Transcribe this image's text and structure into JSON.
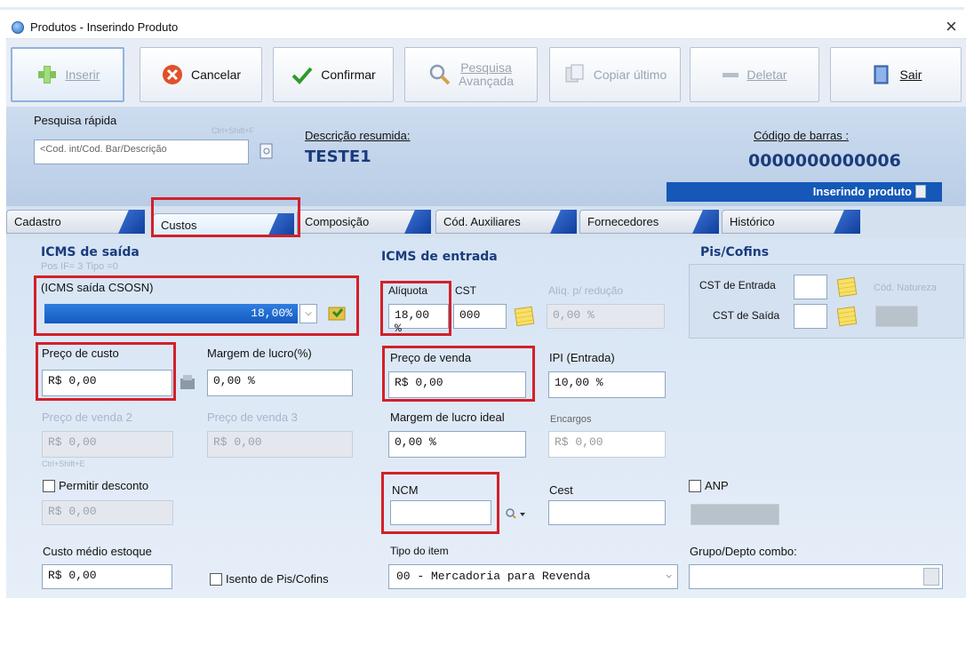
{
  "window": {
    "title": "Produtos - Inserindo Produto",
    "close": "×"
  },
  "toolbar": {
    "insert": "Inserir",
    "cancel": "Cancelar",
    "confirm": "Confirmar",
    "advanced_search_1": "Pesquisa",
    "advanced_search_2": "Avançada",
    "copy_last": "Copiar último",
    "delete": "Deletar",
    "exit": "Sair"
  },
  "header": {
    "quick_search_label": "Pesquisa rápida",
    "quick_search_hint": "Ctrl+Shift+F",
    "quick_search_placeholder": "<Cod. int/Cod. Bar/Descrição",
    "short_desc_label": "Descrição resumida:",
    "short_desc_value": "TESTE1",
    "barcode_label": "Código de barras :",
    "barcode_value": "0000000000006",
    "status": "Inserindo produto"
  },
  "tabs": [
    "Cadastro",
    "Custos",
    "Composição",
    "Cód. Auxiliares",
    "Fornecedores",
    "Histórico"
  ],
  "icms_saida": {
    "title": "ICMS de saída",
    "sub": "Pos IF= 3    Tipo =0",
    "csosn_label": "(ICMS saída CSOSN)",
    "csosn_value": "18,00%"
  },
  "icms_entrada": {
    "title": "ICMS de entrada",
    "aliquota_label": "Alíquota",
    "aliquota_value": "18,00 %",
    "cst_label": "CST",
    "cst_value": "000",
    "reducao_label": "Alíq. p/ redução",
    "reducao_value": "0,00 %"
  },
  "pis": {
    "title": "Pis/Cofins",
    "cst_entrada": "CST de Entrada",
    "cst_saida": "CST de Saída",
    "cod_natureza": "Cód. Natureza"
  },
  "prices": {
    "custo_label": "Preço de custo",
    "custo_value": "R$ 0,00",
    "margem_label": "Margem de lucro(%)",
    "margem_value": "0,00 %",
    "venda_label": "Preço de venda",
    "venda_value": "R$ 0,00",
    "ipi_label": "IPI (Entrada)",
    "ipi_value": "10,00 %",
    "venda2_label": "Preço de venda 2",
    "venda2_value": "R$ 0,00",
    "venda3_label": "Preço de venda 3",
    "venda3_value": "R$ 0,00",
    "shortcut": "Ctrl+Shift+E",
    "margem_ideal_label": "Margem de lucro ideal",
    "margem_ideal_value": "0,00 %",
    "encargos_label": "Encargos",
    "encargos_value": "R$ 0,00"
  },
  "misc": {
    "permitir_desconto": "Permitir desconto",
    "desconto_value": "R$ 0,00",
    "ncm_label": "NCM",
    "cest_label": "Cest",
    "anp_label": "ANP",
    "custo_medio_label": "Custo médio estoque",
    "custo_medio_value": "R$ 0,00",
    "isento": "Isento de Pis/Cofins",
    "tipo_item_label": "Tipo do item",
    "tipo_item_value": "00 - Mercadoria para Revenda",
    "grupo_label": "Grupo/Depto combo:"
  },
  "colors": {
    "highlight": "#d3202a",
    "title_blue": "#1a3c7c",
    "bar_blue": "#1559c0"
  }
}
